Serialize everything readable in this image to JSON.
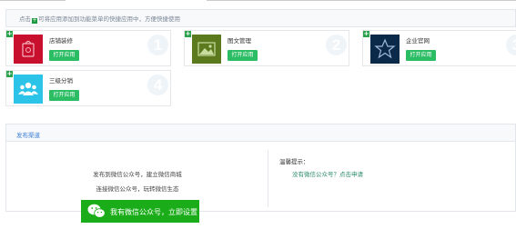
{
  "hint": {
    "prefix": "点击",
    "plus": "+",
    "suffix": "可将应用添加到功能菜单的快捷应用中，方便快捷使用"
  },
  "cards": [
    {
      "title": "店铺装修",
      "button": "打开应用",
      "number": "1",
      "icon": "shop-decoration-icon",
      "color": "#c8102e"
    },
    {
      "title": "图文管理",
      "button": "打开应用",
      "number": "2",
      "icon": "image-icon",
      "color": "#5b7a1e"
    },
    {
      "title": "企业官网",
      "button": "打开应用",
      "number": "3",
      "icon": "star-icon",
      "color": "#0b2a4a"
    },
    {
      "title": "三级分销",
      "button": "打开应用",
      "number": "4",
      "icon": "users-icon",
      "color": "#2bc3e8"
    }
  ],
  "card_add_symbol": "+",
  "publish": {
    "header": "发布渠道",
    "line1": "发布到微信公众号，建立微信商城",
    "line2": "连接微信公众号，玩转微信生态",
    "wechat_button": "我有微信公众号，立即设置",
    "tip_title": "温馨提示：",
    "tip_link": "没有微信公众号？点击申请"
  },
  "colors": {
    "accent_green": "#2bbd64",
    "wechat_green": "#1aad19",
    "link_blue": "#3a7bd5"
  }
}
